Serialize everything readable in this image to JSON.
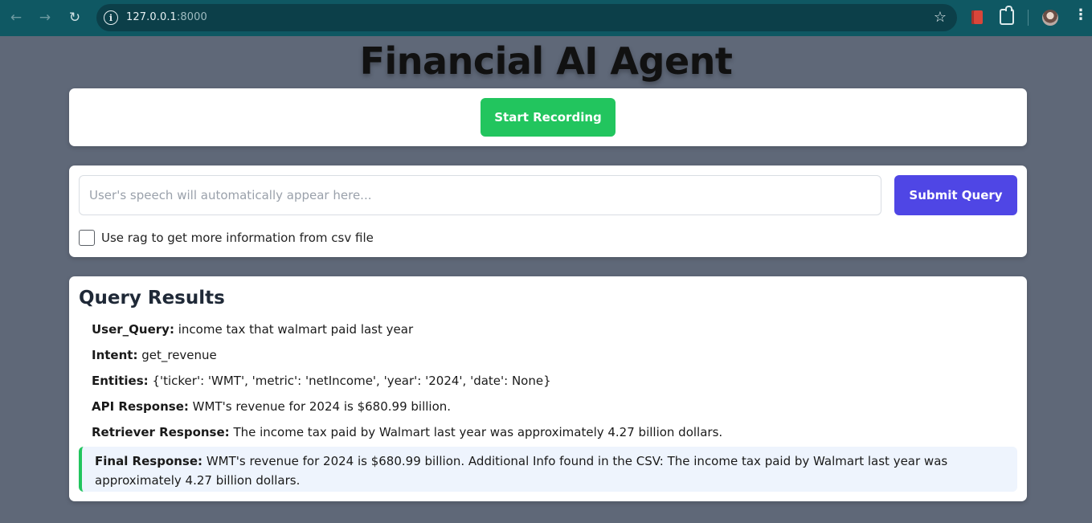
{
  "browser": {
    "url_host": "127.0.0.1",
    "url_port": ":8000",
    "icons": {
      "back": "arrow-left-icon",
      "forward": "arrow-right-icon",
      "reload": "reload-icon",
      "info": "info-icon",
      "bookmark": "star-icon",
      "extension_book": "book-extension-icon",
      "extensions": "puzzle-icon",
      "profile": "avatar",
      "menu": "kebab-menu-icon"
    }
  },
  "page": {
    "title": "Financial AI Agent"
  },
  "recorder": {
    "button_label": "Start Recording"
  },
  "query": {
    "placeholder": "User's speech will automatically appear here...",
    "value": "",
    "submit_label": "Submit Query",
    "rag_checkbox_checked": false,
    "rag_label": "Use rag to get more information from csv file"
  },
  "results": {
    "heading": "Query Results",
    "user_query_label": "User_Query:",
    "user_query_value": "income tax that walmart paid last year",
    "intent_label": "Intent:",
    "intent_value": "get_revenue",
    "entities_label": "Entities:",
    "entities_value": "{'ticker': 'WMT', 'metric': 'netIncome', 'year': '2024', 'date': None}",
    "api_label": "API Response:",
    "api_value": "WMT's revenue for 2024 is $680.99 billion.",
    "retriever_label": "Retriever Response:",
    "retriever_value": "The income tax paid by Walmart last year was approximately 4.27 billion dollars.",
    "final_label": "Final Response:",
    "final_value": "WMT's revenue for 2024 is $680.99 billion. Additional Info found in the CSV: The income tax paid by Walmart last year was approximately 4.27 billion dollars."
  },
  "colors": {
    "page_background": "#5f6878",
    "record_button": "#22c55e",
    "submit_button": "#4f46e5",
    "final_accent": "#22c55e",
    "final_background": "#eef4fd"
  }
}
